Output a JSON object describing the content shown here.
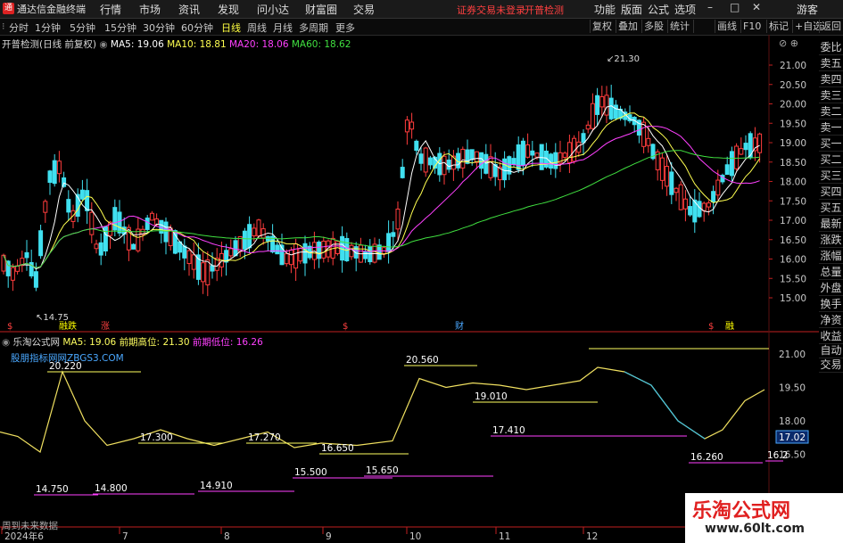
{
  "app": {
    "name": "通达信金融终端",
    "logo_char": "通"
  },
  "menu": [
    "行情",
    "市场",
    "资讯",
    "发现",
    "问小达",
    "财富圈",
    "交易"
  ],
  "warning": {
    "login": "证券交易未登录",
    "check": "开普检测"
  },
  "top_right": [
    "功能",
    "版面",
    "公式",
    "选项",
    "游客"
  ],
  "timeframes": {
    "items": [
      "分时",
      "1分钟",
      "5分钟",
      "15分钟",
      "30分钟",
      "60分钟",
      "日线",
      "周线",
      "月线",
      "多周期",
      "更多"
    ],
    "active_index": 6
  },
  "toolbar_right": [
    "复权",
    "叠加",
    "多股",
    "统计",
    "画线",
    "F10",
    "标记",
    "+自选",
    "返回"
  ],
  "main_info": {
    "stock": "开普检测(日线 前复权)",
    "ma5": "MA5: 19.06",
    "ma10": "MA10: 18.81",
    "ma20": "MA20: 18.06",
    "ma60": "MA60: 18.62",
    "high_label": "21.30",
    "low_label": "14.75"
  },
  "price_axis": [
    "21.00",
    "20.50",
    "20.00",
    "19.50",
    "19.00",
    "18.50",
    "18.00",
    "17.50",
    "17.00",
    "16.50",
    "16.00",
    "15.50",
    "15.00"
  ],
  "markers": [
    {
      "text": "$",
      "color": "#ff4040"
    },
    {
      "text": "融跌",
      "color": "#ffff00"
    },
    {
      "text": "涨",
      "color": "#ff4040"
    },
    {
      "text": "$",
      "color": "#ff4040"
    },
    {
      "text": "财",
      "color": "#4aa8ff"
    },
    {
      "text": "$",
      "color": "#ff4040"
    },
    {
      "text": "融",
      "color": "#ffff00"
    }
  ],
  "right_panel": [
    "委比",
    "卖五",
    "卖四",
    "卖三",
    "卖二",
    "卖一",
    "买一",
    "买二",
    "买三",
    "买四",
    "买五",
    "最新",
    "涨跌",
    "涨幅",
    "总量",
    "外盘",
    "换手",
    "净资",
    "收益"
  ],
  "right_panel_bottom": [
    "自动",
    "交易"
  ],
  "indicator_info": {
    "name": "乐淘公式网",
    "ma5": "MA5: 19.06",
    "prev_high": "前期高位: 21.30",
    "prev_low": "前期低位: 16.26",
    "site": "股朋指标网网ZBGS3.COM"
  },
  "indicator_axis": [
    "21.00",
    "19.50",
    "18.00",
    "16.50"
  ],
  "current_value": "17.02",
  "levels": [
    {
      "text": "20.220",
      "color": "#ffffff"
    },
    {
      "text": "17.300",
      "color": "#ffffff"
    },
    {
      "text": "17.270",
      "color": "#ffffff"
    },
    {
      "text": "16.650",
      "color": "#ffffff"
    },
    {
      "text": "20.560",
      "color": "#ffffff"
    },
    {
      "text": "19.010",
      "color": "#ffffff"
    },
    {
      "text": "17.410",
      "color": "#ffffff"
    },
    {
      "text": "14.750",
      "color": "#ffffff"
    },
    {
      "text": "14.800",
      "color": "#ffffff"
    },
    {
      "text": "14.910",
      "color": "#ffffff"
    },
    {
      "text": "15.500",
      "color": "#ffffff"
    },
    {
      "text": "15.650",
      "color": "#ffffff"
    },
    {
      "text": "16.260",
      "color": "#ffffff"
    },
    {
      "text": "16.2",
      "color": "#ffffff"
    }
  ],
  "future_data": "周到未来数据",
  "date_axis": [
    "2024年6",
    "7",
    "8",
    "9",
    "10",
    "11",
    "12"
  ],
  "watermark": {
    "title": "乐淘公式网",
    "url": "www.60lt.com"
  },
  "colors": {
    "up": "#ff3c3c",
    "down": "#40e0f0",
    "ma5": "#ffffff",
    "ma10": "#ffff50",
    "ma20": "#ff40ff",
    "ma60": "#40e040",
    "indicator": "#ffff60"
  }
}
